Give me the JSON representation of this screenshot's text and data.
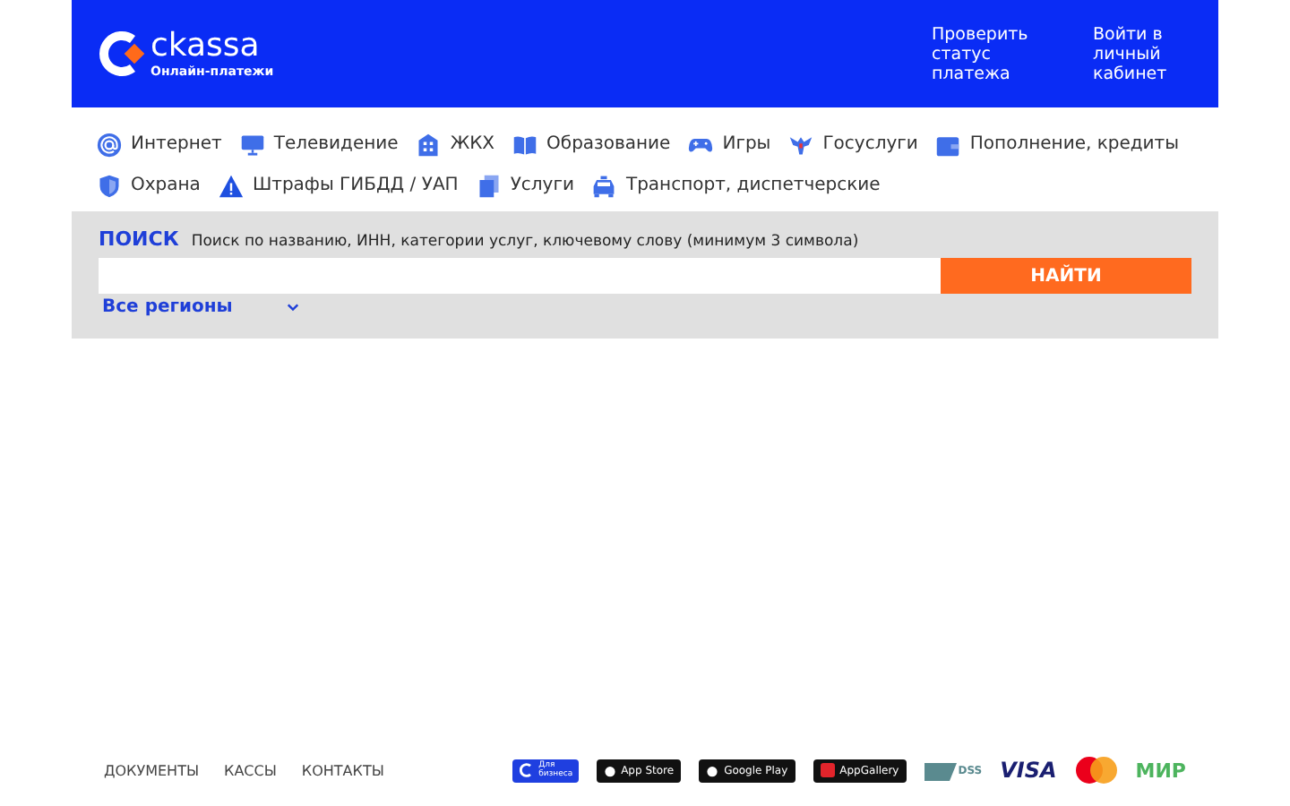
{
  "header": {
    "logo": {
      "name": "ckassa",
      "tagline": "Онлайн-платежи"
    },
    "links": [
      "Проверить статус платежа",
      "Войти в личный кабинет"
    ]
  },
  "categories": [
    {
      "label": "Интернет",
      "kind": "at"
    },
    {
      "label": "Телевидение",
      "kind": "tv"
    },
    {
      "label": "ЖКХ",
      "kind": "building"
    },
    {
      "label": "Образование",
      "kind": "book"
    },
    {
      "label": "Игры",
      "kind": "gamepad"
    },
    {
      "label": "Госуслуги",
      "kind": "eagle"
    },
    {
      "label": "Пополнение, кредиты",
      "kind": "wallet"
    },
    {
      "label": "Охрана",
      "kind": "shield"
    },
    {
      "label": "Штрафы ГИБДД / УАП",
      "kind": "warning"
    },
    {
      "label": "Услуги",
      "kind": "document"
    },
    {
      "label": "Транспорт, диспетчерские",
      "kind": "car"
    }
  ],
  "search": {
    "title": "ПОИСК",
    "hint": "Поиск по названию, ИНН, категории услуг, ключевому слову (минимум 3 символа)",
    "button": "НАЙТИ",
    "region": "Все регионы"
  },
  "footer": {
    "links": [
      "ДОКУМЕНТЫ",
      "КАССЫ",
      "КОНТАКТЫ"
    ],
    "badges": [
      {
        "kind": "business",
        "text": "Для бизнеса"
      },
      {
        "kind": "store",
        "text": "App Store"
      },
      {
        "kind": "store",
        "text": "Google Play"
      },
      {
        "kind": "gallery",
        "text": "AppGallery"
      },
      {
        "kind": "pci",
        "text": "DSS"
      },
      {
        "kind": "visa",
        "text": "VISA"
      },
      {
        "kind": "mastercard"
      },
      {
        "kind": "mir",
        "text": "МИР"
      }
    ]
  }
}
